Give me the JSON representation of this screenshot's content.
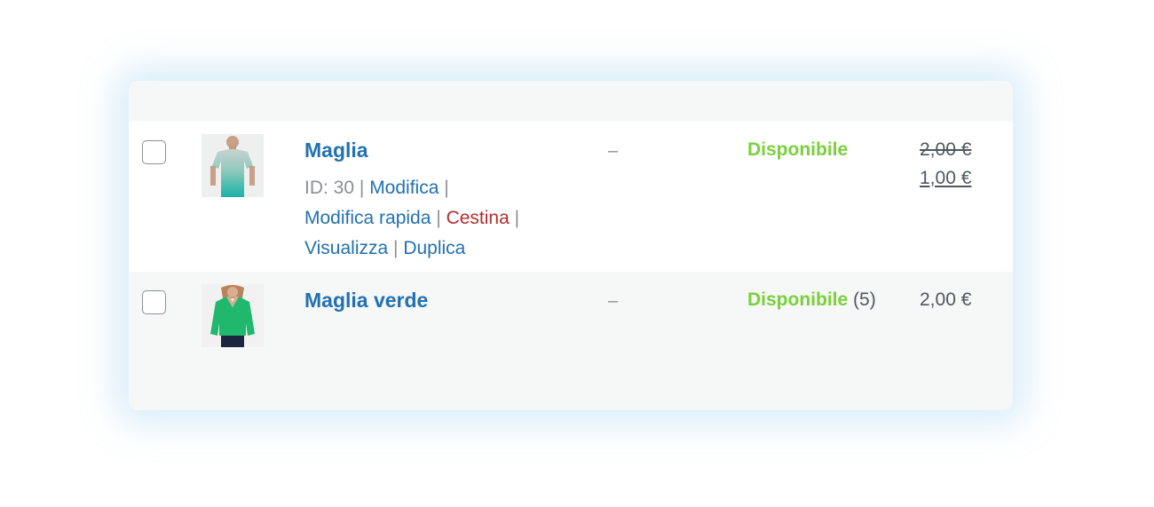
{
  "products": [
    {
      "name": "Maglia",
      "id_label": "ID: 30",
      "actions": {
        "edit": "Modifica",
        "quick_edit": "Modifica rapida",
        "trash": "Cestina",
        "view": "Visualizza",
        "duplicate": "Duplica"
      },
      "separator": "|",
      "sku": "–",
      "stock_status": "Disponibile",
      "regular_price": "2,00 €",
      "sale_price": "1,00 €",
      "thumbnail_icon": "tshirt-product-image"
    },
    {
      "name": "Maglia verde",
      "sku": "–",
      "stock_status": "Disponibile",
      "stock_count": "(5)",
      "price": "2,00 €",
      "thumbnail_icon": "green-blouse-product-image"
    }
  ],
  "colors": {
    "link": "#2271b1",
    "trash": "#b32d2e",
    "in_stock": "#7ad03a",
    "muted": "#8c8f94",
    "row_alt": "#f6f7f7"
  }
}
